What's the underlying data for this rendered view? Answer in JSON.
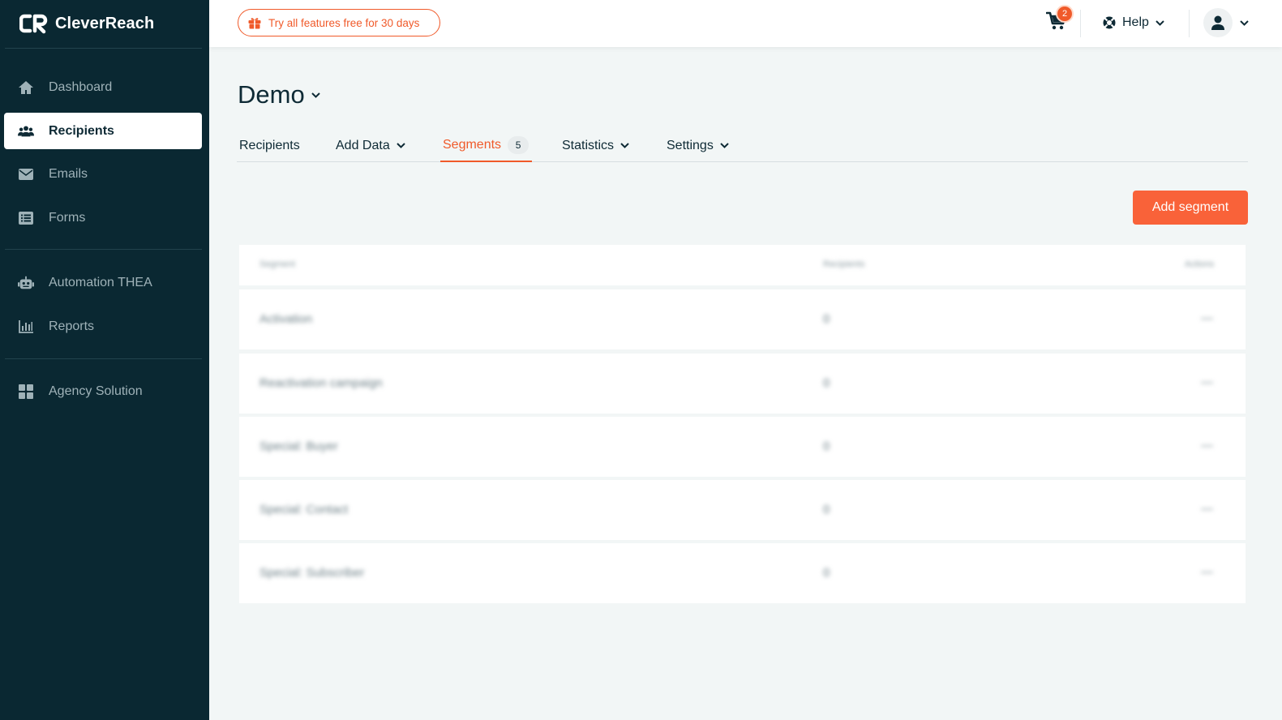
{
  "brand": {
    "name": "CleverReach",
    "accent": "#f05a2a",
    "sidebar_bg": "#0a2832"
  },
  "sidebar": {
    "items": [
      {
        "label": "Dashboard",
        "icon": "home-icon",
        "active": false
      },
      {
        "label": "Recipients",
        "icon": "users-icon",
        "active": true
      },
      {
        "label": "Emails",
        "icon": "envelope-icon",
        "active": false
      },
      {
        "label": "Forms",
        "icon": "list-icon",
        "active": false
      },
      {
        "label": "Automation THEA",
        "icon": "robot-icon",
        "active": false
      },
      {
        "label": "Reports",
        "icon": "bar-chart-icon",
        "active": false
      },
      {
        "label": "Agency Solution",
        "icon": "grid-icon",
        "active": false
      }
    ]
  },
  "topbar": {
    "trial_label": "Try all features free for 30 days",
    "cart_count": "2",
    "help_label": "Help"
  },
  "main": {
    "title": "Demo",
    "tabs": [
      {
        "label": "Recipients",
        "has_dropdown": false
      },
      {
        "label": "Add Data",
        "has_dropdown": true
      },
      {
        "label": "Segments",
        "count": "5",
        "active": true
      },
      {
        "label": "Statistics",
        "has_dropdown": true
      },
      {
        "label": "Settings",
        "has_dropdown": true
      }
    ],
    "add_button_label": "Add segment",
    "table": {
      "headers": [
        "Segment",
        "Recipients",
        "Actions"
      ],
      "rows": [
        {
          "name": "Activation",
          "count": "0",
          "action": "—"
        },
        {
          "name": "Reactivation campaign",
          "count": "0",
          "action": "—"
        },
        {
          "name": "Special: Buyer",
          "count": "0",
          "action": "—"
        },
        {
          "name": "Special: Contact",
          "count": "0",
          "action": "—"
        },
        {
          "name": "Special: Subscriber",
          "count": "0",
          "action": "—"
        }
      ]
    }
  }
}
